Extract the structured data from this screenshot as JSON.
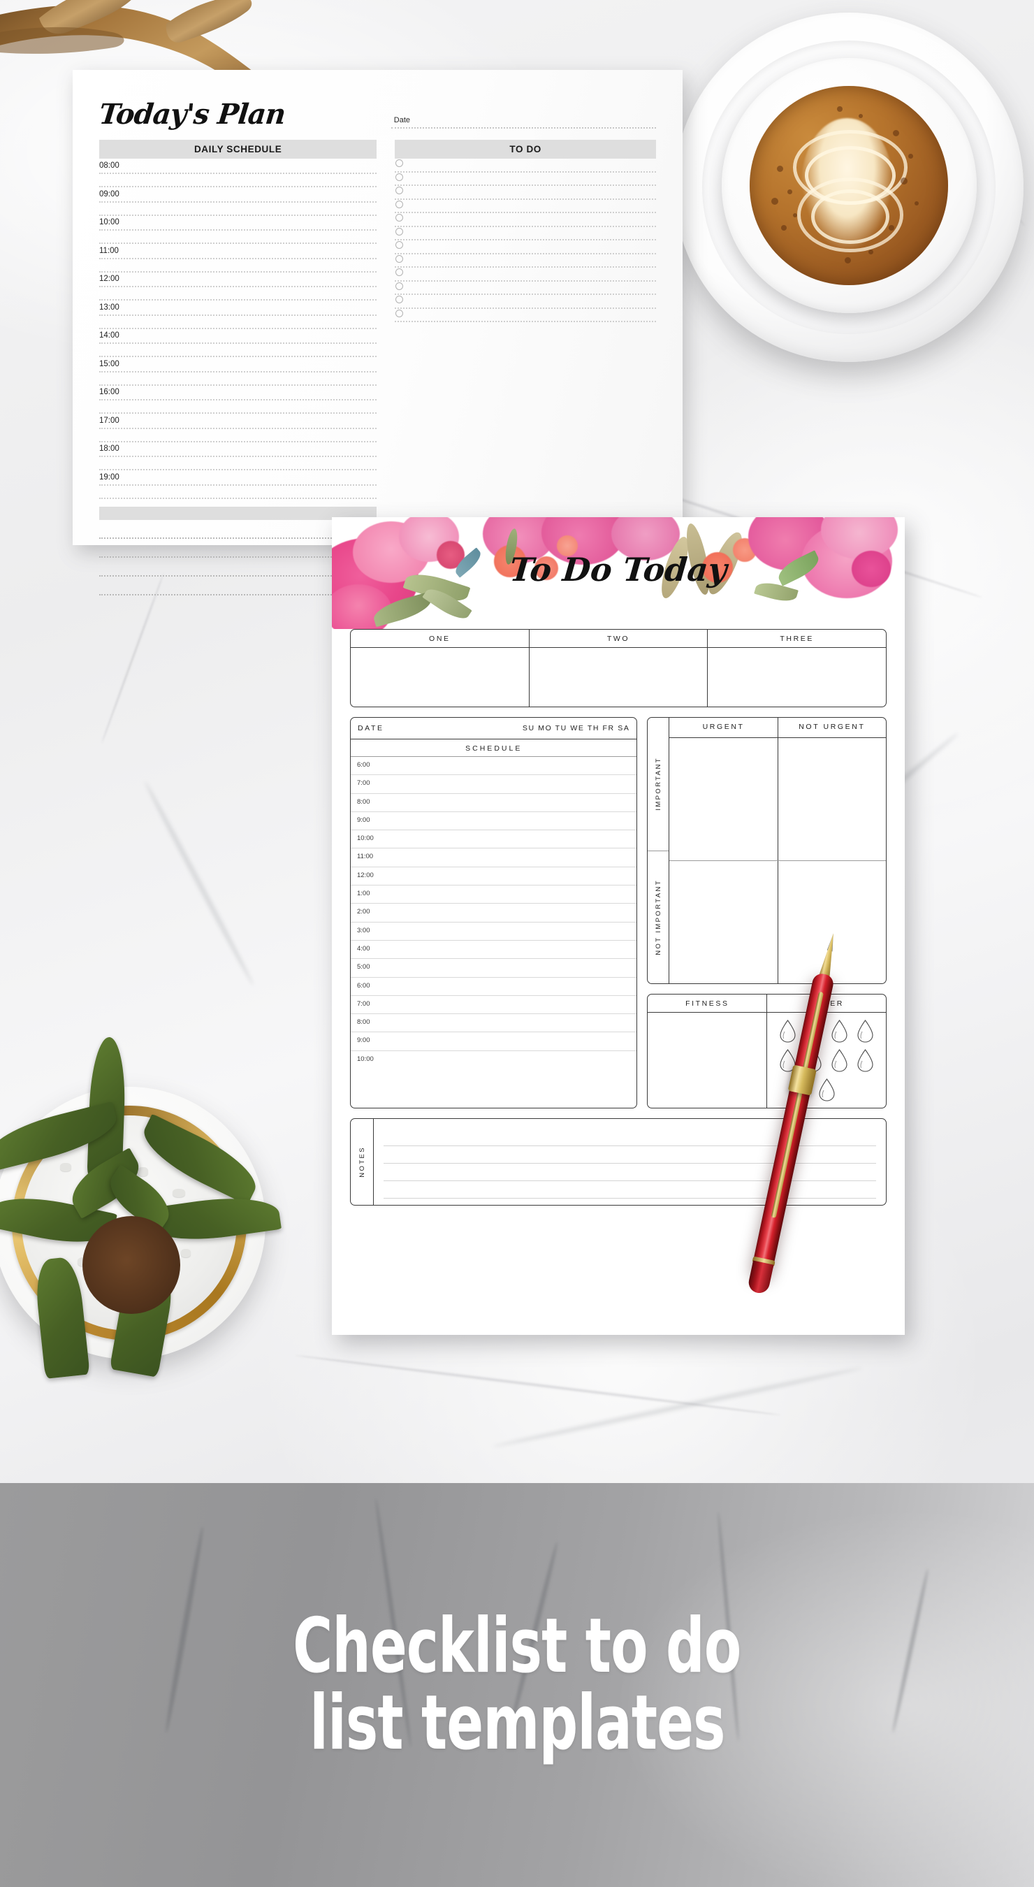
{
  "banner": {
    "line1": "Checklist to do",
    "line2": "list templates"
  },
  "planner_one": {
    "title": "Today's Plan",
    "date_label": "Date",
    "schedule_header": "DAILY SCHEDULE",
    "todo_header": "TO DO",
    "times": [
      "08:00",
      "09:00",
      "10:00",
      "11:00",
      "12:00",
      "13:00",
      "14:00",
      "15:00",
      "16:00",
      "17:00",
      "18:00",
      "19:00"
    ],
    "todo_items_count": 12,
    "header_band_color": "#dedede"
  },
  "planner_two": {
    "title": "To Do Today",
    "top_three": [
      "ONE",
      "TWO",
      "THREE"
    ],
    "schedule": {
      "date_label": "DATE",
      "days": "SU MO TU WE TH FR SA",
      "header": "SCHEDULE",
      "times": [
        "6:00",
        "7:00",
        "8:00",
        "9:00",
        "10:00",
        "11:00",
        "12:00",
        "1:00",
        "2:00",
        "3:00",
        "4:00",
        "5:00",
        "6:00",
        "7:00",
        "8:00",
        "9:00",
        "10:00"
      ]
    },
    "matrix": {
      "columns": [
        "URGENT",
        "NOT URGENT"
      ],
      "rows": [
        "IMPORTANT",
        "NOT IMPORTANT"
      ]
    },
    "trackers": {
      "fitness_label": "FITNESS",
      "water_label": "WATER",
      "water_drop_count": 9
    },
    "notes_label": "NOTES",
    "notes_line_count": 4,
    "floral_colors": {
      "pink_deep": "#e8468a",
      "pink_mid": "#f06fa6",
      "pink_light": "#f7b3cd",
      "coral": "#f4806b",
      "green_sage": "#9fae77",
      "green_olive": "#8a9a5b",
      "tan": "#c9b78e"
    }
  },
  "props": {
    "coffee": "coffee-cup-latte-art",
    "plant": "succulent-plant-pot",
    "pen": "red-gold-ballpoint-pen",
    "antler": "deer-antler",
    "surface": "white-marble"
  }
}
